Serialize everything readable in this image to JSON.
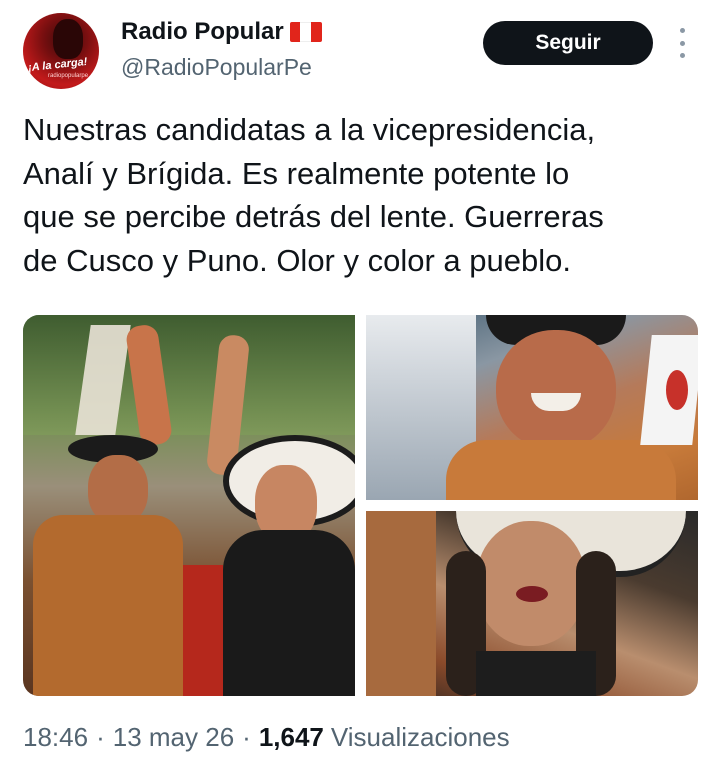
{
  "account": {
    "display_name": "Radio Popular",
    "handle": "@RadioPopularPe",
    "avatar_text": "¡A la carga!",
    "avatar_subtext": "radiopopularpe",
    "flag_icon": "peru-flag-icon"
  },
  "follow_button": {
    "label": "Seguir"
  },
  "more_menu": {
    "icon": "more-vertical-icon"
  },
  "tweet": {
    "text": "Nuestras candidatas a la vicepresidencia,\nAnalí y Brígida. Es realmente potente lo\nque se percibe detrás del lente. Guerreras\nde Cusco y Puno. Olor y color a pueblo."
  },
  "media": [
    {
      "name": "photo-rally-crowd"
    },
    {
      "name": "photo-smiling-woman"
    },
    {
      "name": "photo-woman-speaking"
    }
  ],
  "meta": {
    "time": "18:46",
    "date": "13 may 26",
    "views_count": "1,647",
    "views_label": "Visualizaciones",
    "separator": "·"
  },
  "colors": {
    "text": "#0f1419",
    "secondary": "#536471",
    "button": "#0f1419"
  }
}
